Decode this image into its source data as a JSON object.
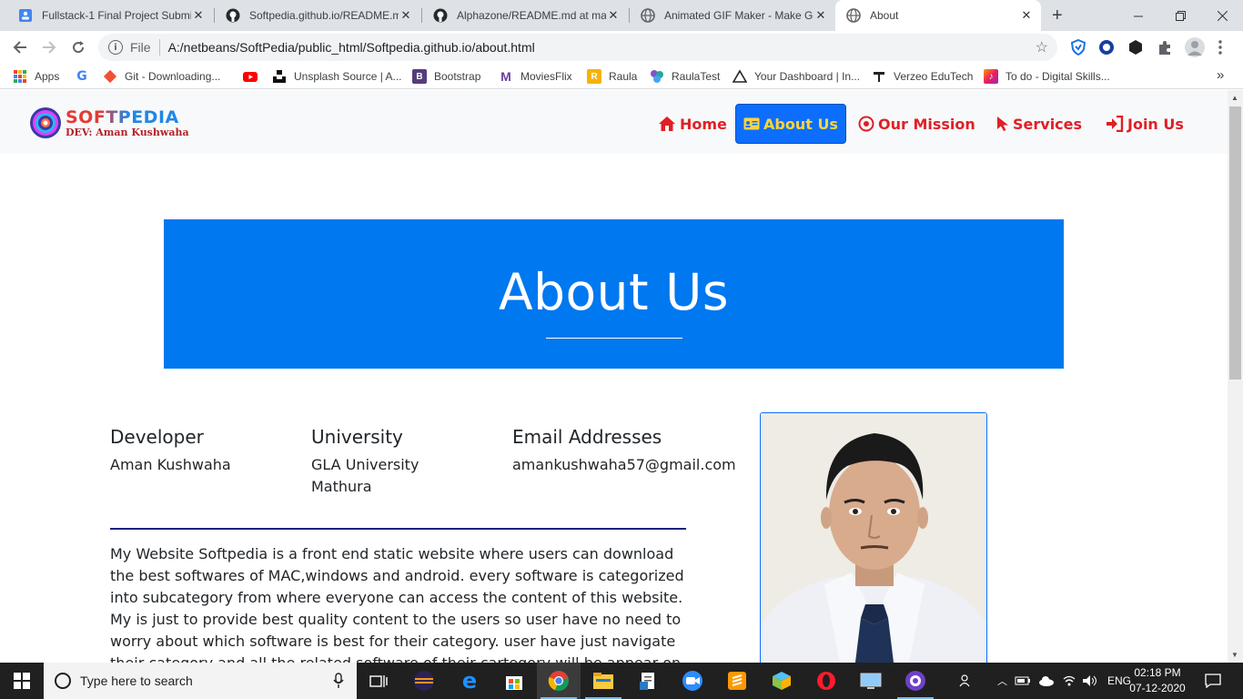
{
  "browser": {
    "tabs": [
      {
        "title": "Fullstack-1 Final Project Submi",
        "favicon": "docs-icon",
        "active": false
      },
      {
        "title": "Softpedia.github.io/README.m",
        "favicon": "github-icon",
        "active": false
      },
      {
        "title": "Alphazone/README.md at ma",
        "favicon": "github-icon",
        "active": false
      },
      {
        "title": "Animated GIF Maker - Make G",
        "favicon": "globe-icon",
        "active": false
      },
      {
        "title": "About",
        "favicon": "globe-icon",
        "active": true
      }
    ],
    "close_glyph": "✕",
    "new_tab_glyph": "+",
    "address": {
      "scheme_label": "File",
      "url": "A:/netbeans/SoftPedia/public_html/Softpedia.github.io/about.html"
    },
    "bookmarks": [
      {
        "label": "Apps",
        "icon": "apps-grid-icon",
        "color": "#ea4335"
      },
      {
        "label": "",
        "icon": "google-icon",
        "color": "#4285f4"
      },
      {
        "label": "Git - Downloading...",
        "icon": "git-icon",
        "color": "#f05033"
      },
      {
        "label": "",
        "icon": "youtube-icon",
        "color": "#ff0000"
      },
      {
        "label": "Unsplash Source | A...",
        "icon": "unsplash-icon",
        "color": "#111111"
      },
      {
        "label": "Bootstrap",
        "icon": "bootstrap-icon",
        "color": "#563d7c"
      },
      {
        "label": "MoviesFlix",
        "icon": "moviesflix-icon",
        "color": "#6b3fa0"
      },
      {
        "label": "Raula",
        "icon": "raula-icon",
        "color": "#f4b400"
      },
      {
        "label": "RaulaTest",
        "icon": "raulatest-icon",
        "color": "#7e57c2"
      },
      {
        "label": "Your Dashboard | In...",
        "icon": "dashboard-icon",
        "color": "#222222"
      },
      {
        "label": "Verzeo EduTech",
        "icon": "verzeo-icon",
        "color": "#222222"
      },
      {
        "label": "To do - Digital Skills...",
        "icon": "todo-icon",
        "color": "#e91e63"
      }
    ],
    "bookmarks_overflow": "»"
  },
  "site": {
    "brand": "SOFTPEDIA",
    "brand_sub": "DEV: Aman Kushwaha",
    "nav": [
      {
        "label": "Home",
        "icon": "home-icon",
        "active": false
      },
      {
        "label": "About Us",
        "icon": "id-card-icon",
        "active": true
      },
      {
        "label": "Our Mission",
        "icon": "target-icon",
        "active": false
      },
      {
        "label": "Services",
        "icon": "pointer-icon",
        "active": false
      },
      {
        "label": "Join Us",
        "icon": "sign-in-icon",
        "active": false
      }
    ],
    "hero_title": "About Us",
    "info": [
      {
        "heading": "Developer",
        "value": "Aman Kushwaha"
      },
      {
        "heading": "University",
        "value": "GLA University Mathura"
      },
      {
        "heading": "Email Addresses",
        "value": "amankushwaha57@gmail.com"
      }
    ],
    "paragraph": "My Website Softpedia is a front end static website where users can download the best softwares of MAC,windows and android. every software is categorized into subcategory from where everyone can access the content of this website. My is just to provide best quality content to the users so user have no need to worry about which software is best for their category. user have just navigate their category and all the related software of their cartegory will be appear on"
  },
  "taskbar": {
    "search_placeholder": "Type here to search",
    "language": "ENG",
    "time": "02:18 PM",
    "date": "07-12-2020"
  }
}
